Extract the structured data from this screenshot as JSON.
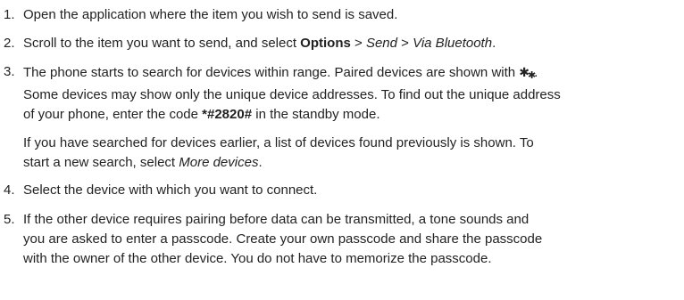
{
  "steps": [
    {
      "number": "1.",
      "text": "Open the application where the item you wish to send is saved."
    },
    {
      "number": "2.",
      "text_a": "Scroll to the item you want to send, and select ",
      "options": "Options",
      "sep1": " > ",
      "send": "Send",
      "sep2": " > ",
      "via": "Via Bluetooth",
      "end": "."
    },
    {
      "number": "3.",
      "line1": "The phone starts to search for devices within range. Paired devices are shown with ",
      "line1_end": ".",
      "line2": "Some devices may show only the unique device addresses. To find out the unique address",
      "line3_a": "of your phone, enter the code ",
      "code": "*#2820#",
      "line3_b": " in the standby mode.",
      "paired_icon": "bluetooth-paired-icon"
    },
    {
      "number": "4.",
      "text": "Select the device with which you want to connect."
    },
    {
      "number": "5.",
      "line1": "If the other device requires pairing before data can be transmitted, a tone sounds and",
      "line2": "you are asked to enter a passcode. Create your own passcode and share the passcode",
      "line3": "with the owner of the other device. You do not have to memorize the passcode."
    }
  ],
  "note": {
    "line1": "If you have searched for devices earlier, a list of devices found previously is shown. To",
    "line2_a": "start a new search, select ",
    "more": "More devices",
    "line2_b": "."
  }
}
